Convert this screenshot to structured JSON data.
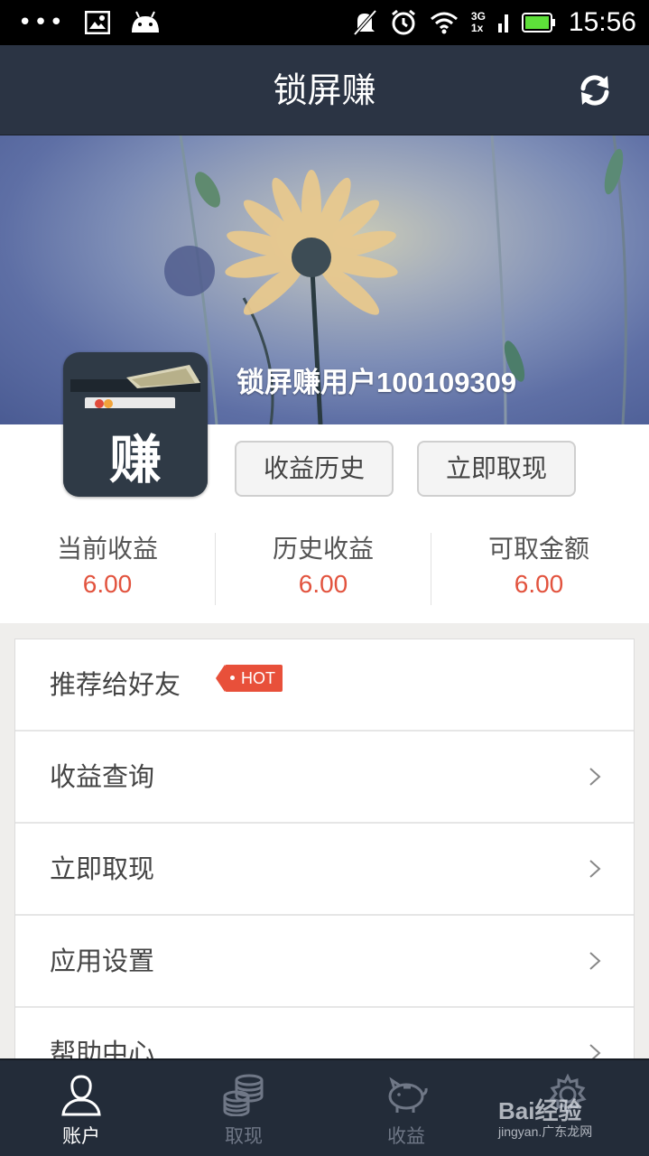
{
  "status_bar": {
    "time": "15:56",
    "network_top": "3G",
    "network_bottom": "1x",
    "icons": [
      "dots-icon",
      "image-notification-icon",
      "android-icon",
      "mute-icon",
      "alarm-icon",
      "wifi-icon",
      "signal-icon",
      "battery-icon"
    ]
  },
  "header": {
    "title": "锁屏赚",
    "refresh_icon": "refresh-icon"
  },
  "profile": {
    "avatar_char": "赚",
    "username": "锁屏赚用户100109309",
    "buttons": {
      "history": "收益历史",
      "withdraw": "立即取现"
    }
  },
  "stats": [
    {
      "label": "当前收益",
      "value": "6.00"
    },
    {
      "label": "历史收益",
      "value": "6.00"
    },
    {
      "label": "可取金额",
      "value": "6.00"
    }
  ],
  "menu": {
    "items": [
      {
        "label": "推荐给好友",
        "badge": "HOT"
      },
      {
        "label": "收益查询"
      },
      {
        "label": "立即取现"
      },
      {
        "label": "应用设置"
      },
      {
        "label": "帮助中心"
      }
    ]
  },
  "bottom_nav": {
    "items": [
      {
        "label": "账户",
        "icon": "account-icon",
        "active": true
      },
      {
        "label": "取现",
        "icon": "coins-icon",
        "active": false
      },
      {
        "label": "收益",
        "icon": "piggy-bank-icon",
        "active": false
      },
      {
        "label": "",
        "icon": "settings-icon",
        "active": false
      }
    ]
  },
  "watermark": {
    "brand": "Bai经验",
    "url": "jingyan.广东龙网"
  },
  "colors": {
    "header_bg": "#2b3444",
    "accent_red": "#e2533e",
    "badge_red": "#e8503a",
    "nav_bg": "#232c39"
  }
}
